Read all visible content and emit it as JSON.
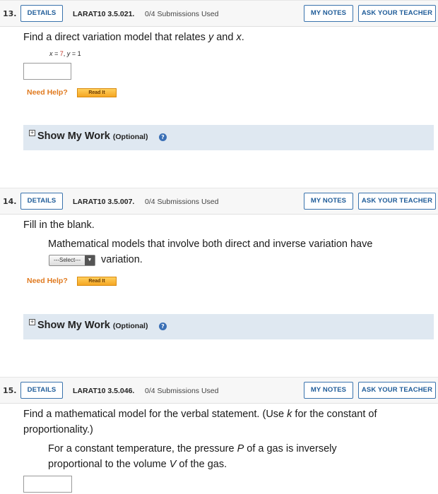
{
  "common": {
    "details_label": "DETAILS",
    "my_notes_label": "MY NOTES",
    "ask_teacher_label": "ASK YOUR TEACHER",
    "need_help_label": "Need Help?",
    "read_it_label": "Read It",
    "show_my_work_label": "Show My Work",
    "optional_label": "(Optional)"
  },
  "questions": [
    {
      "number": "13.",
      "code": "LARAT10 3.5.021.",
      "submissions": "0/4 Submissions Used",
      "prompt_before": "Find a direct variation model that relates ",
      "var1": "y",
      "prompt_mid": " and ",
      "var2": "x",
      "prompt_after": ".",
      "givens": {
        "x_label": "x = ",
        "x_value": "7",
        "sep": ", ",
        "y_label": "y = ",
        "y_value": "1"
      },
      "answer_value": ""
    },
    {
      "number": "14.",
      "code": "LARAT10 3.5.007.",
      "submissions": "0/4 Submissions Used",
      "prompt": "Fill in the blank.",
      "statement_line1": "Mathematical models that involve both direct and inverse variation have",
      "select_value": "---Select---",
      "statement_line2": "variation."
    },
    {
      "number": "15.",
      "code": "LARAT10 3.5.046.",
      "submissions": "0/4 Submissions Used",
      "prompt_line1_before": "Find a mathematical model for the verbal statement. (Use ",
      "prompt_var": "k",
      "prompt_line1_after": " for the constant of",
      "prompt_line2": "proportionality.)",
      "statement_line1_before": "For a constant temperature, the pressure ",
      "statement_var1": "P",
      "statement_line1_after": " of a gas is inversely",
      "statement_line2_before": "proportional to the volume ",
      "statement_var2": "V",
      "statement_line2_after": " of the gas.",
      "answer_value": ""
    }
  ]
}
